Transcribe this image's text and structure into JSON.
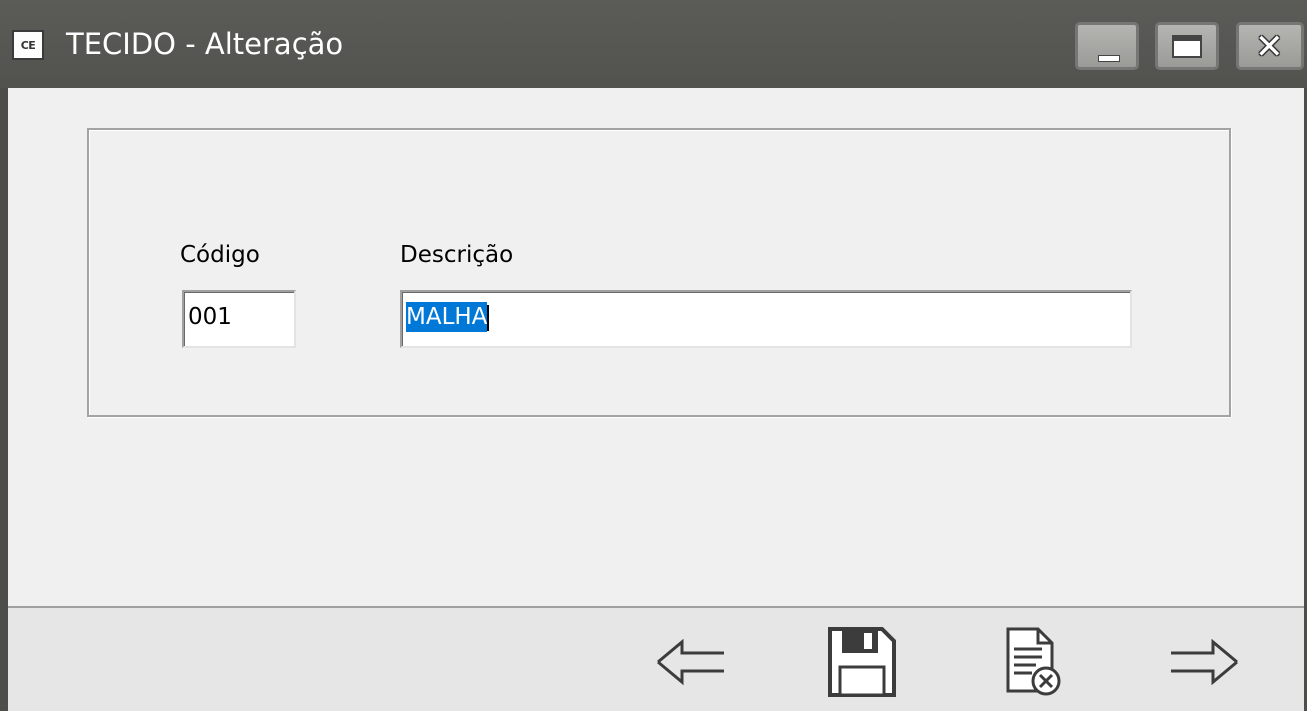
{
  "window": {
    "title": "TECIDO - Alteração",
    "app_icon_text": "CE",
    "icons": {
      "app": "app-icon",
      "minimize": "minimize-icon",
      "maximize": "maximize-icon",
      "close": "close-icon"
    }
  },
  "form": {
    "codigo_label": "Código",
    "codigo_value": "001",
    "descricao_label": "Descrição",
    "descricao_value": "MALHA"
  },
  "toolbar": {
    "icons": [
      "arrow-left-icon",
      "save-icon",
      "cancel-document-icon",
      "arrow-right-icon"
    ]
  },
  "colors": {
    "titlebar": "#52524e",
    "selection": "#0078d7",
    "background": "#f0f0f0"
  }
}
